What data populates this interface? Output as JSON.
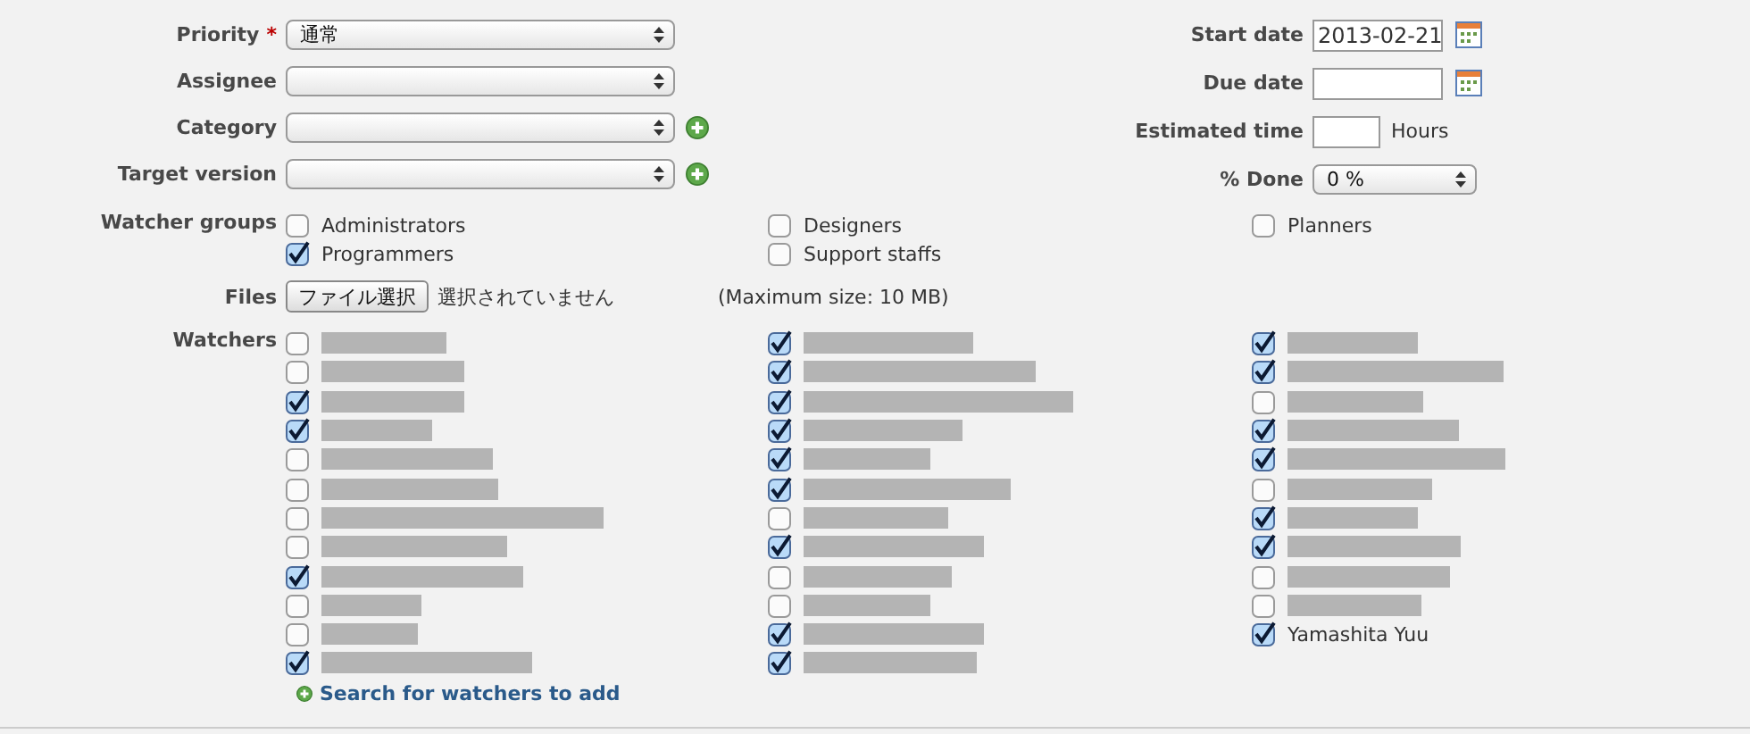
{
  "left_fields": [
    {
      "label": "Priority",
      "required_mark": "*",
      "kind": "select",
      "value": "通常",
      "add": false
    },
    {
      "label": "Assignee",
      "kind": "select",
      "add": false
    },
    {
      "label": "Category",
      "kind": "select",
      "add": true
    },
    {
      "label": "Target version",
      "kind": "select",
      "add": true
    }
  ],
  "right_fields": [
    {
      "label": "Start date",
      "kind": "date",
      "value": "2013-02-21"
    },
    {
      "label": "Due date",
      "kind": "date"
    },
    {
      "label": "Estimated time",
      "kind": "hours",
      "unit": "Hours"
    },
    {
      "label": "% Done",
      "kind": "select",
      "value": "0 %"
    }
  ],
  "watcher_groups": {
    "label": "Watcher groups",
    "columns": [
      [
        {
          "name": "Administrators",
          "checked": false
        },
        {
          "name": "Programmers",
          "checked": true
        }
      ],
      [
        {
          "name": "Designers",
          "checked": false
        },
        {
          "name": "Support staffs",
          "checked": false
        }
      ],
      [
        {
          "name": "Planners",
          "checked": false
        }
      ]
    ]
  },
  "files": {
    "label": "Files",
    "button": "ファイル選択",
    "status": "選択されていません",
    "note": "(Maximum size: 10 MB)"
  },
  "watchers": {
    "label": "Watchers",
    "columns": [
      [
        {
          "checked": false
        },
        {
          "checked": false
        },
        {
          "checked": true
        },
        {
          "checked": true
        },
        {
          "checked": false
        },
        {
          "checked": false
        },
        {
          "checked": false
        },
        {
          "checked": false
        },
        {
          "checked": true
        },
        {
          "checked": false
        },
        {
          "checked": false
        },
        {
          "checked": true
        }
      ],
      [
        {
          "checked": true
        },
        {
          "checked": true
        },
        {
          "checked": true
        },
        {
          "checked": true
        },
        {
          "checked": true
        },
        {
          "checked": true
        },
        {
          "checked": false
        },
        {
          "checked": true
        },
        {
          "checked": false
        },
        {
          "checked": false
        },
        {
          "checked": true
        },
        {
          "checked": true
        }
      ],
      [
        {
          "checked": true
        },
        {
          "checked": true
        },
        {
          "checked": false
        },
        {
          "checked": true
        },
        {
          "checked": true
        },
        {
          "checked": false
        },
        {
          "checked": true
        },
        {
          "checked": true
        },
        {
          "checked": false
        },
        {
          "checked": false
        },
        {
          "checked": true,
          "name": "Yamashita Yuu"
        }
      ]
    ],
    "search_link": "Search for watchers to add"
  }
}
